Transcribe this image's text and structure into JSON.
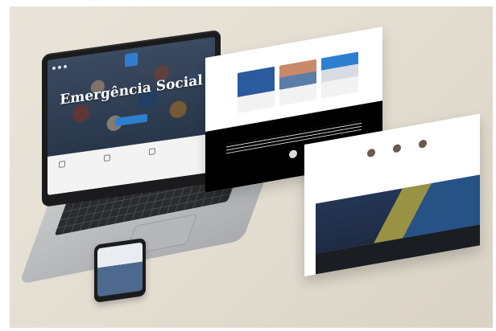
{
  "scene": {
    "description_visible_text_only": "",
    "laptop": {
      "hero_title": "Emergência Social"
    }
  },
  "colors": {
    "accent": "#2f7fd1",
    "background": "#e6e0d5",
    "dark": "#000000"
  },
  "icons": {
    "logo": "square-logo-icon",
    "nav_dots": "menu-dots-icon",
    "avatar": "avatar-icon"
  }
}
